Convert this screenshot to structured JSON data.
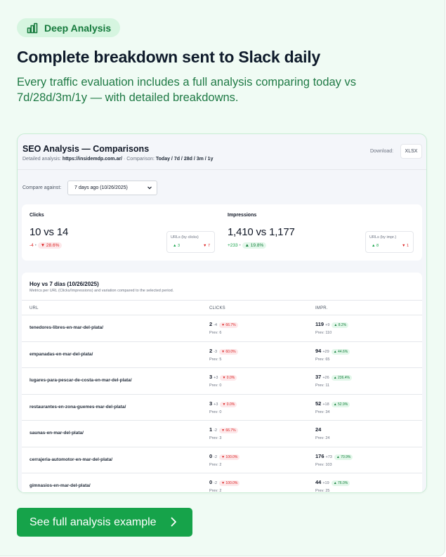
{
  "badge": {
    "label": "Deep Analysis",
    "icon": "bar-chart-icon"
  },
  "headline": "Complete breakdown sent to Slack daily",
  "subtext": "Every traffic evaluation includes a full analysis comparing today vs 7d/28d/3m/1y — with detailed breakdowns.",
  "preview": {
    "title": "SEO Analysis — Comparisons",
    "subtitle_prefix": "Detailed analysis:",
    "site": "https://insidemdp.com.ar/",
    "comparison_prefix": "· Comparison:",
    "comparison_periods": "Today / 7d / 28d / 3m / 1y",
    "download_label": "Download:",
    "download_button": "XLSX",
    "compare_label": "Compare against:",
    "compare_value": "7 days ago (10/26/2025)",
    "metrics": {
      "clicks": {
        "label": "Clicks",
        "value": "10 vs 14",
        "delta": "-4",
        "pct": "▼ 28.6%",
        "urls_label": "URLs (by clicks)",
        "urls_up": "▲ 3",
        "urls_down": "▼ 7"
      },
      "impressions": {
        "label": "Impressions",
        "value": "1,410 vs 1,177",
        "delta": "+233",
        "pct": "▲ 19.8%",
        "urls_label": "URLs (by impr.)",
        "urls_up": "▲ 8",
        "urls_down": "▼ 1"
      }
    },
    "table": {
      "title": "Hoy vs 7 días (10/26/2025)",
      "subtitle": "Metrics per URL (Clicks/Impressions) and variation compared to the selected period.",
      "headers": {
        "url": "URL",
        "clicks": "CLICKS",
        "impr": "IMPR."
      },
      "rows": [
        {
          "url": "tenedores-libres-en-mar-del-plata/",
          "clicks": "2",
          "clicks_delta": "-4",
          "clicks_pct": "▼ 66.7%",
          "clicks_dir": "neg",
          "clicks_prev": "Prev: 6",
          "impr": "119",
          "impr_delta": "+9",
          "impr_pct": "▲ 8.2%",
          "impr_dir": "pos",
          "impr_prev": "Prev: 110"
        },
        {
          "url": "empanadas-en-mar-del-plata/",
          "clicks": "2",
          "clicks_delta": "-3",
          "clicks_pct": "▼ 60.0%",
          "clicks_dir": "neg",
          "clicks_prev": "Prev: 5",
          "impr": "94",
          "impr_delta": "+29",
          "impr_pct": "▲ 44.6%",
          "impr_dir": "pos",
          "impr_prev": "Prev: 65"
        },
        {
          "url": "lugares-para-pescar-de-costa-en-mar-del-plata/",
          "clicks": "3",
          "clicks_delta": "+3",
          "clicks_pct": "▼ 0.0%",
          "clicks_dir": "neg",
          "clicks_prev": "Prev: 0",
          "impr": "37",
          "impr_delta": "+26",
          "impr_pct": "▲ 236.4%",
          "impr_dir": "pos",
          "impr_prev": "Prev: 11"
        },
        {
          "url": "restaurantes-en-zona-guemes-mar-del-plata/",
          "clicks": "3",
          "clicks_delta": "+3",
          "clicks_pct": "▼ 0.0%",
          "clicks_dir": "neg",
          "clicks_prev": "Prev: 0",
          "impr": "52",
          "impr_delta": "+18",
          "impr_pct": "▲ 52.9%",
          "impr_dir": "pos",
          "impr_prev": "Prev: 34"
        },
        {
          "url": "saunas-en-mar-del-plata/",
          "clicks": "1",
          "clicks_delta": "-2",
          "clicks_pct": "▼ 66.7%",
          "clicks_dir": "neg",
          "clicks_prev": "Prev: 3",
          "impr": "24",
          "impr_delta": "",
          "impr_pct": "",
          "impr_dir": "pos",
          "impr_prev": "Prev: 24"
        },
        {
          "url": "cerrajeria-automotor-en-mar-del-plata/",
          "clicks": "0",
          "clicks_delta": "-2",
          "clicks_pct": "▼ 100.0%",
          "clicks_dir": "neg",
          "clicks_prev": "Prev: 2",
          "impr": "176",
          "impr_delta": "+73",
          "impr_pct": "▲ 70.9%",
          "impr_dir": "pos",
          "impr_prev": "Prev: 103"
        },
        {
          "url": "gimnasios-en-mar-del-plata/",
          "clicks": "0",
          "clicks_delta": "-2",
          "clicks_pct": "▼ 100.0%",
          "clicks_dir": "neg",
          "clicks_prev": "Prev: 2",
          "impr": "44",
          "impr_delta": "+19",
          "impr_pct": "▲ 76.0%",
          "impr_dir": "pos",
          "impr_prev": "Prev: 25"
        }
      ]
    }
  },
  "cta": {
    "label": "See full analysis example",
    "icon": "chevron-right-icon"
  },
  "colors": {
    "accent": "#16a34a",
    "badge_bg": "#d6f5e0",
    "card_bg": "#f0fbf4",
    "negative": "#dc2626",
    "positive": "#16a34a"
  }
}
